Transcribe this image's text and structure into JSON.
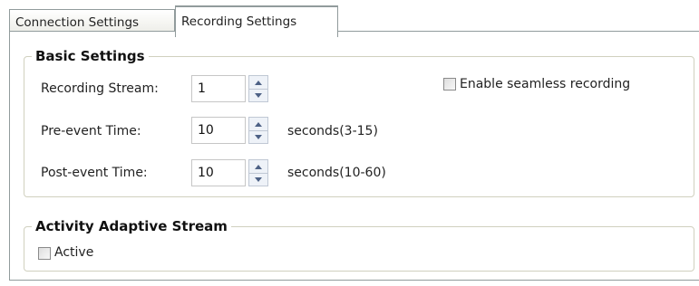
{
  "tabs": [
    {
      "label": "Connection Settings",
      "active": false
    },
    {
      "label": "Recording Settings",
      "active": true
    }
  ],
  "basic": {
    "title": "Basic Settings",
    "stream_label": "Recording Stream:",
    "stream_value": "1",
    "pre_label": "Pre-event Time:",
    "pre_value": "10",
    "pre_unit": "seconds(3-15)",
    "post_label": "Post-event Time:",
    "post_value": "10",
    "post_unit": "seconds(10-60)",
    "seamless_label": "Enable seamless recording",
    "seamless_checked": false
  },
  "adaptive": {
    "title": "Activity Adaptive Stream",
    "active_label": "Active",
    "active_checked": false
  }
}
